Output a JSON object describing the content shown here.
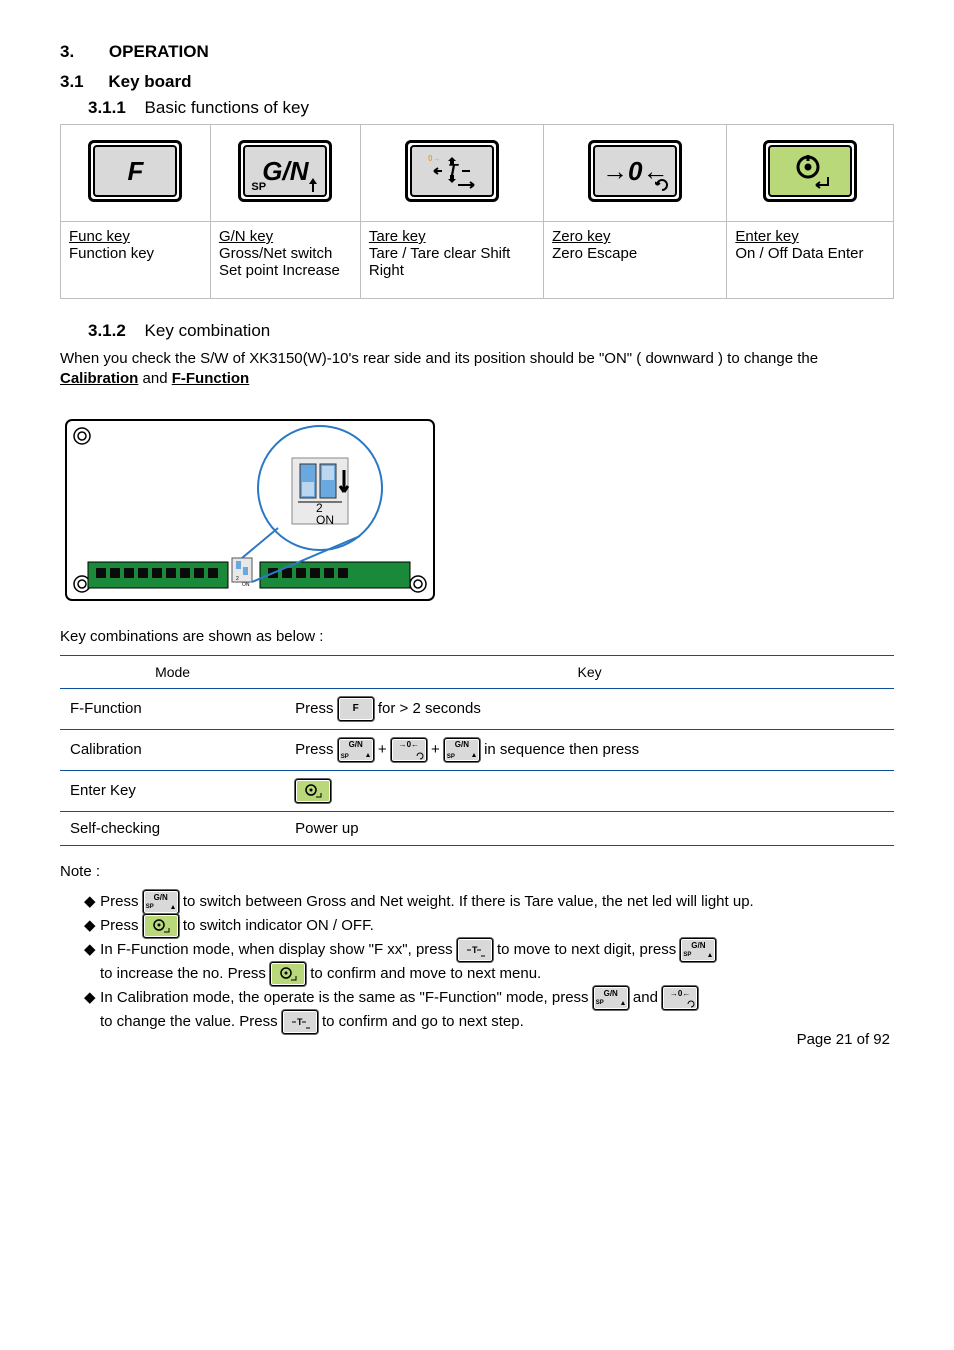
{
  "headings": {
    "h1_num": "3.",
    "h1_text": "OPERATION",
    "h2_num": "3.1",
    "h2_text": "Key board",
    "h3_num": "3.1.1",
    "h3_text": "Basic functions of key"
  },
  "big_keys": {
    "F": {
      "label": "Func key",
      "desc": "Function key"
    },
    "GN": {
      "label": "G/N key",
      "desc": "Gross/Net switch Set point Increase",
      "main": "G/N",
      "sub_sp": "SP"
    },
    "T": {
      "label": "Tare key",
      "desc": "Tare / Tare clear Shift Right"
    },
    "Zero": {
      "label": "Zero key",
      "desc": "Zero Escape",
      "main": "→0←"
    },
    "Enter": {
      "label": "Enter key",
      "desc": "On / Off Data Enter"
    }
  },
  "combo_section": {
    "h_num": "3.1.2",
    "h_text": "Key combination",
    "intro_prefix": "When you check the S/W of XK3150(W)-10's rear side and its position should be \"ON\" ( downward ) to change the ",
    "intro_em": "Calibration",
    "intro_and": " and ",
    "intro_em2": "F-Function",
    "intro_suffix": "",
    "post_fig": "Key combinations are shown as below :",
    "header_l": "Mode",
    "header_r": "Key",
    "r1_l": "F-Function",
    "r1_r_pre": "Press ",
    "r1_r_suf": " for > 2 seconds",
    "r2_l": "Calibration",
    "r2_r_pre": "Press ",
    "r2_r_mid": " + ",
    "r2_r_suf": " in sequence then press",
    "r3_l": "Enter Key",
    "r3_r": "",
    "r4_l": "Self-checking",
    "r4_r": "Power up"
  },
  "device_fig": {
    "sw_label_top": "2",
    "sw_label_bottom": "ON"
  },
  "notes": {
    "title": "Note :",
    "n1_a": "Press ",
    "n1_b": " to switch between Gross and Net weight. If there is Tare value, the net led will light up.",
    "n2_a": "Press ",
    "n2_b": " to switch indicator ON / OFF.",
    "n3_a": "In F-Function mode, when display show \"F xx\", press ",
    "n3_b": " to move to next digit, press",
    "n4_a": "to increase the no. Press ",
    "n4_b": " to confirm and move to next menu.",
    "n5_a": "In Calibration mode, the operate is the same as \"F-Function\" mode, press ",
    "n5_b": " and",
    "n6_a": "to change the value. Press ",
    "n6_b": " to confirm and go to next step."
  },
  "page_footer": "Page 21 of 92"
}
